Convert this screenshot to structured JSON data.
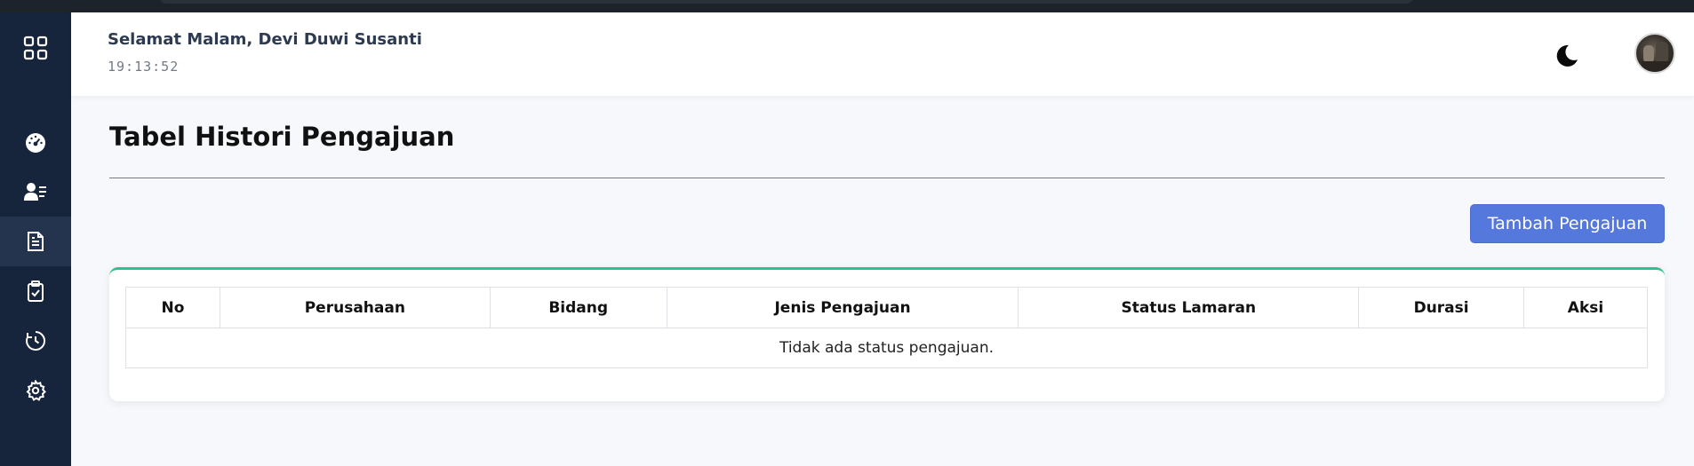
{
  "header": {
    "greeting": "Selamat Malam, Devi Duwi Susanti",
    "clock": "19:13:52"
  },
  "sidebar": {
    "items": [
      {
        "icon": "apps-grid-icon"
      },
      {
        "icon": "dashboard-gauge-icon"
      },
      {
        "icon": "user-list-icon"
      },
      {
        "icon": "document-icon",
        "active": true
      },
      {
        "icon": "clipboard-check-icon"
      },
      {
        "icon": "history-clock-icon"
      },
      {
        "icon": "gear-icon"
      }
    ]
  },
  "main": {
    "title": "Tabel Histori Pengajuan",
    "add_button_label": "Tambah Pengajuan",
    "table": {
      "columns": [
        "No",
        "Perusahaan",
        "Bidang",
        "Jenis Pengajuan",
        "Status Lamaran",
        "Durasi",
        "Aksi"
      ],
      "empty_message": "Tidak ada status pengajuan."
    }
  },
  "colors": {
    "sidebar_bg": "#17253c",
    "accent_button": "#5478db",
    "card_top_border": "#2fc08f"
  }
}
